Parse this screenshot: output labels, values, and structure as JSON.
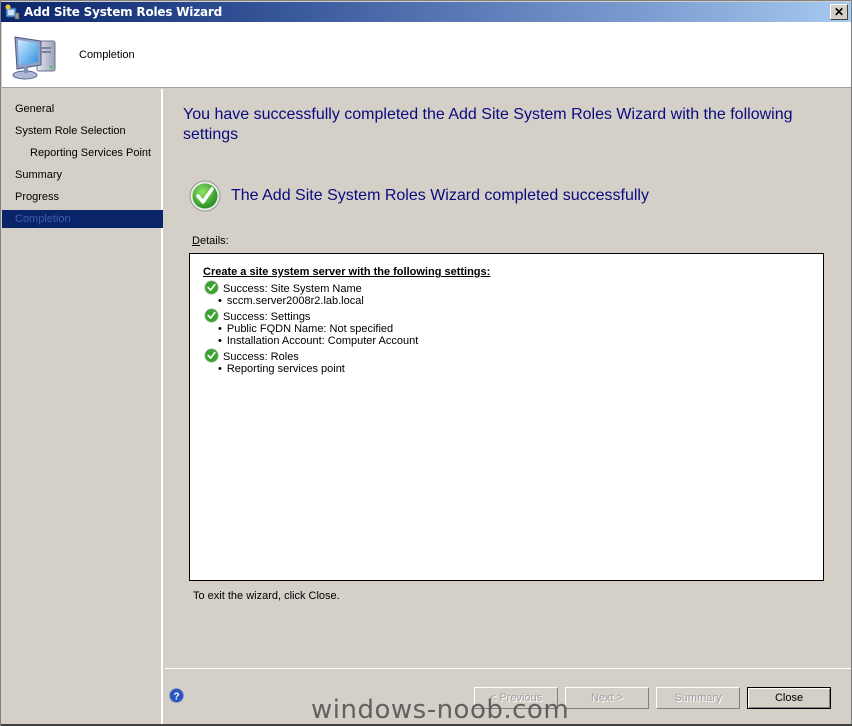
{
  "window": {
    "title": "Add Site System Roles Wizard",
    "close_label": "X"
  },
  "header": {
    "title": "Completion",
    "icon": "computer-icon"
  },
  "sidebar": {
    "items": [
      {
        "label": "General",
        "sub": false,
        "active": false
      },
      {
        "label": "System Role Selection",
        "sub": false,
        "active": false
      },
      {
        "label": "Reporting Services Point",
        "sub": true,
        "active": false
      },
      {
        "label": "Summary",
        "sub": false,
        "active": false
      },
      {
        "label": "Progress",
        "sub": false,
        "active": false
      },
      {
        "label": "Completion",
        "sub": false,
        "active": true
      }
    ]
  },
  "main": {
    "heading": "You have successfully completed the Add Site System Roles Wizard with the following settings",
    "success_message": "The Add Site System Roles Wizard completed successfully",
    "details_label_accel": "D",
    "details_label_rest": "etails:",
    "details": {
      "heading": "Create a site system server with the following settings:",
      "groups": [
        {
          "status": "Success: Site System Name",
          "bullets": [
            "sccm.server2008r2.lab.local"
          ]
        },
        {
          "status": "Success: Settings",
          "bullets": [
            "Public FQDN Name: Not specified",
            "Installation Account: Computer Account"
          ]
        },
        {
          "status": "Success: Roles",
          "bullets": [
            "Reporting services point"
          ]
        }
      ]
    },
    "exit_text": "To exit the wizard, click Close."
  },
  "buttons": {
    "previous": "< Previous",
    "next": "Next >",
    "summary": "Summary",
    "close": "Close"
  },
  "watermark": "windows-noob.com",
  "colors": {
    "heading": "#0a0a80",
    "active_nav_bg": "#0a246a",
    "dialog_bg": "#d4d0c8"
  }
}
